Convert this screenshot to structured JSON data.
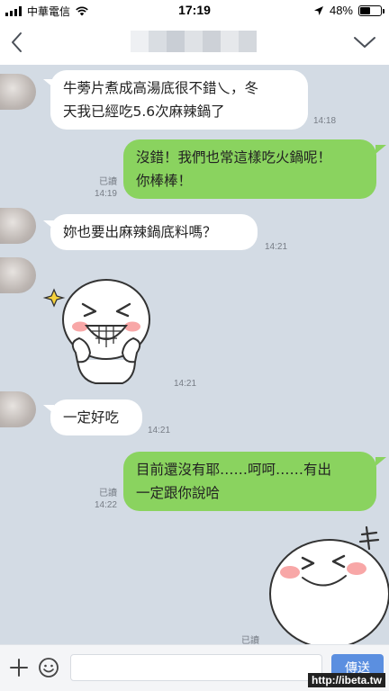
{
  "status_bar": {
    "carrier": "中華電信",
    "time": "17:19",
    "battery": "48%",
    "battery_level": 0.48
  },
  "header": {
    "back_icon": "chevron-left-icon",
    "menu_icon": "chevron-down-icon"
  },
  "messages": [
    {
      "side": "in",
      "lines": [
        "牛蒡片煮成高湯底很不錯乀，冬",
        "天我已經吃5.6次麻辣鍋了"
      ],
      "time": "14:18"
    },
    {
      "side": "out",
      "lines": [
        "沒錯！我們也常這樣吃火鍋呢！",
        "你棒棒！"
      ],
      "read": "已讀",
      "time": "14:19"
    },
    {
      "side": "in",
      "lines": [
        "妳也要出麻辣鍋底料嗎？"
      ],
      "time": "14:21"
    },
    {
      "side": "in",
      "sticker": "grinning-face-sticker",
      "time": "14:21"
    },
    {
      "side": "in",
      "lines": [
        "一定好吃"
      ],
      "time": "14:21"
    },
    {
      "side": "out",
      "lines": [
        "目前還沒有耶……呵呵……有出",
        "一定跟你說哈"
      ],
      "read": "已讀",
      "time": "14:22"
    },
    {
      "side": "out",
      "sticker": "laughing-face-sticker",
      "read": "已讀"
    }
  ],
  "input_bar": {
    "placeholder": "",
    "send_label": "傳送",
    "plus_icon": "plus-icon",
    "emoji_icon": "emoji-icon"
  },
  "watermark": "http://ibeta.tw",
  "colors": {
    "chat_background": "#d3dbe4",
    "outgoing_bubble": "#8ad35f",
    "incoming_bubble": "#ffffff",
    "send_button": "#5b8fe0"
  }
}
